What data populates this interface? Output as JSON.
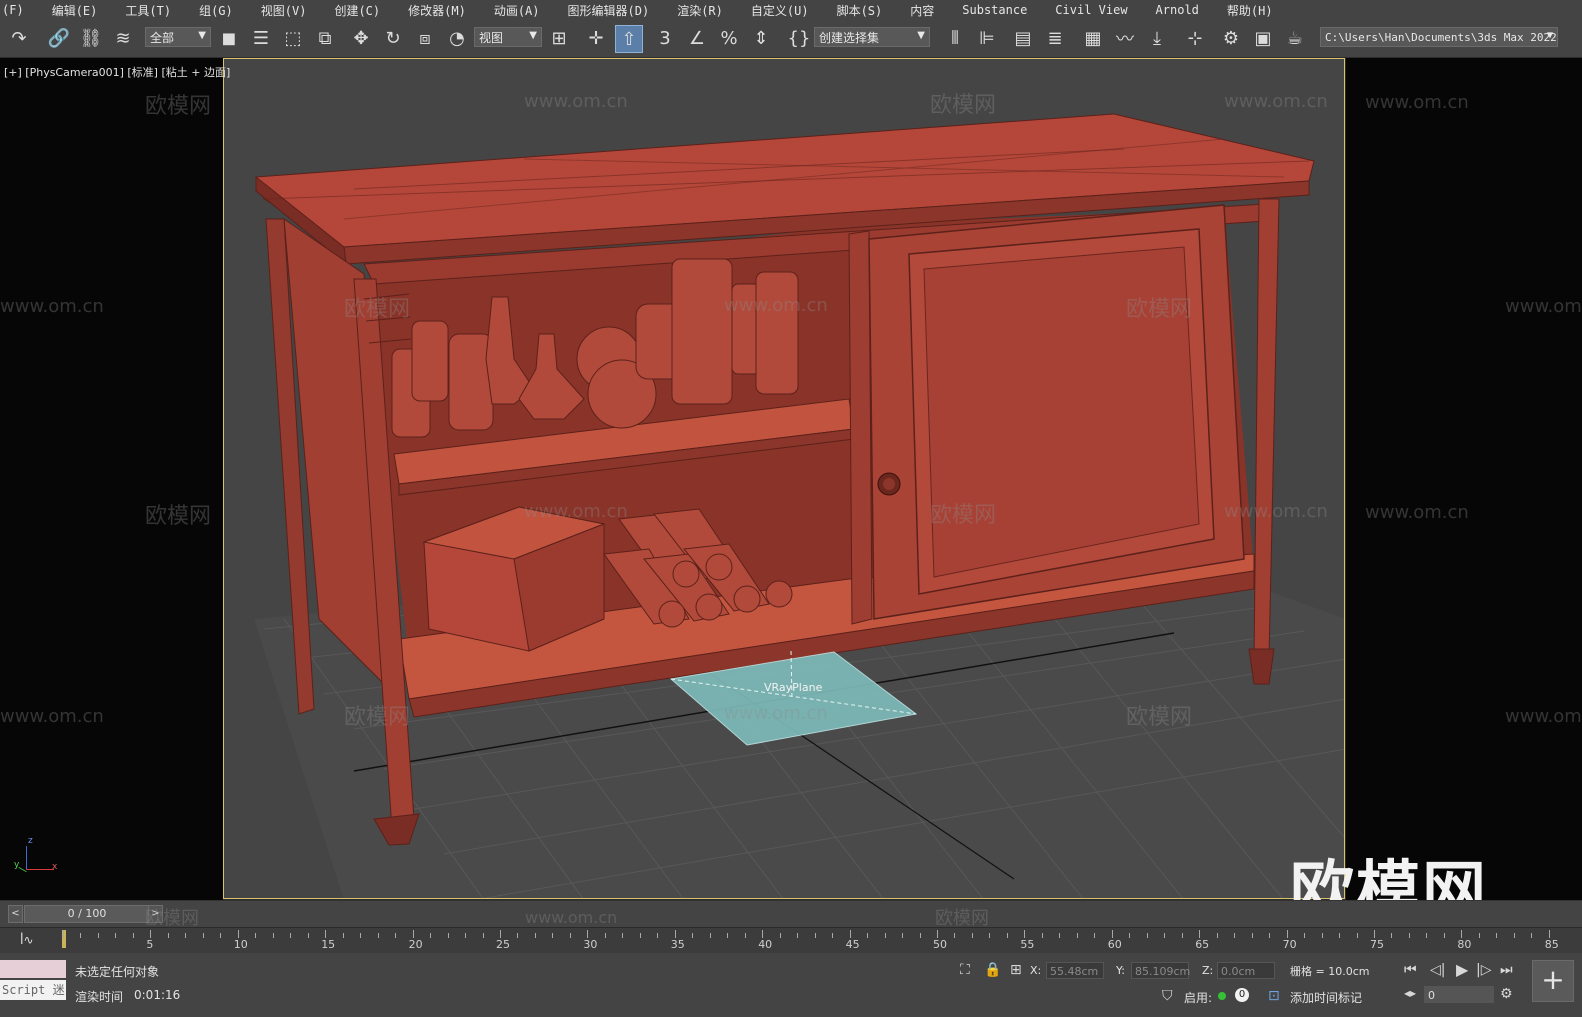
{
  "menu": [
    "(F)",
    "编辑(E)",
    "工具(T)",
    "组(G)",
    "视图(V)",
    "创建(C)",
    "修改器(M)",
    "动画(A)",
    "图形编辑器(D)",
    "渲染(R)",
    "自定义(U)",
    "脚本(S)",
    "内容",
    "Substance",
    "Civil View",
    "Arnold",
    "帮助(H)"
  ],
  "toolbar": {
    "filter_value": "全部",
    "coord_value": "视图",
    "snap_num": "3",
    "selection_set": "创建选择集",
    "project_path": "C:\\Users\\Han\\Documents\\3ds Max 2022"
  },
  "viewport": {
    "label": "[+] [PhysCamera001] [标准] [粘土 + 边面]",
    "object_label": "VRayPlane",
    "watermark_text": "欧模网",
    "watermark_url": "www.om.cn",
    "big_watermark": "欧模网",
    "axis_x": "x",
    "axis_y": "y",
    "axis_z": "z"
  },
  "timeline": {
    "frame_display": "0 / 100",
    "ticks": [
      "5",
      "10",
      "15",
      "20",
      "25",
      "30",
      "35",
      "40",
      "45",
      "50",
      "55",
      "60",
      "65",
      "70",
      "75",
      "80",
      "85"
    ]
  },
  "status": {
    "selection_text": "未选定任何对象",
    "render_time_label": "渲染时间",
    "render_time_value": "0:01:16",
    "script_label": "Script 迷",
    "x_label": "X:",
    "x_value": "55.48cm",
    "y_label": "Y:",
    "y_value": "85.109cm",
    "z_label": "Z:",
    "z_value": "0.0cm",
    "grid_text": "栅格 = 10.0cm",
    "enable_label": "启用:",
    "enable_value": "0",
    "add_time_tag": "添加时间标记",
    "frame_field": "0"
  },
  "colors": {
    "clay": "#b24a3c",
    "clay_dark": "#7d2e24",
    "viewport_bg": "#454545",
    "active_border": "#d8c36b",
    "plane": "#7fbdbd"
  }
}
